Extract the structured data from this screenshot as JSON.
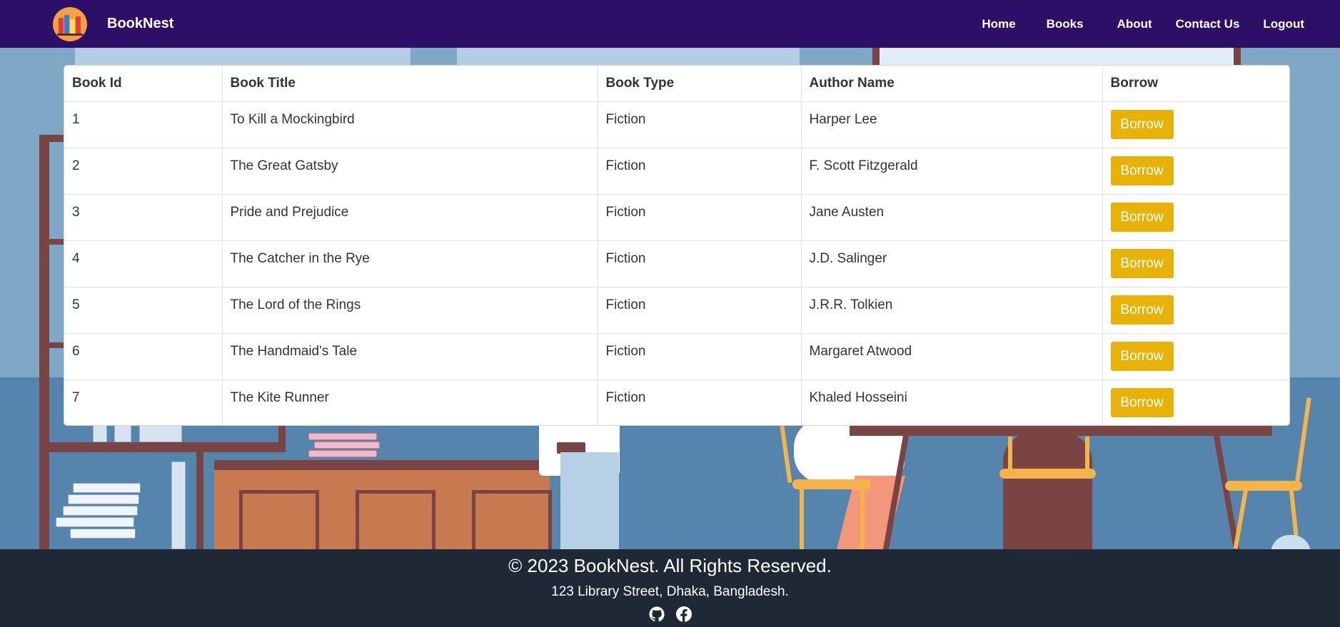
{
  "navbar": {
    "brand": "BookNest",
    "links": [
      "Home",
      "Books",
      "About",
      "Contact Us",
      "Logout"
    ],
    "logo_icon": "books-logo-icon"
  },
  "table": {
    "headers": [
      "Book Id",
      "Book Title",
      "Book Type",
      "Author Name",
      "Borrow"
    ],
    "rows": [
      {
        "id": "1",
        "title": "To Kill a Mockingbird",
        "type": "Fiction",
        "author": "Harper Lee",
        "action": "Borrow"
      },
      {
        "id": "2",
        "title": "The Great Gatsby",
        "type": "Fiction",
        "author": "F. Scott Fitzgerald",
        "action": "Borrow"
      },
      {
        "id": "3",
        "title": "Pride and Prejudice",
        "type": "Fiction",
        "author": "Jane Austen",
        "action": "Borrow"
      },
      {
        "id": "4",
        "title": "The Catcher in the Rye",
        "type": "Fiction",
        "author": "J.D. Salinger",
        "action": "Borrow"
      },
      {
        "id": "5",
        "title": "The Lord of the Rings",
        "type": "Fiction",
        "author": "J.R.R. Tolkien",
        "action": "Borrow"
      },
      {
        "id": "6",
        "title": "The Handmaid's Tale",
        "type": "Fiction",
        "author": "Margaret Atwood",
        "action": "Borrow"
      },
      {
        "id": "7",
        "title": "The Kite Runner",
        "type": "Fiction",
        "author": "Khaled Hosseini",
        "action": "Borrow"
      }
    ]
  },
  "footer": {
    "copyright": "© 2023 BookNest. All Rights Reserved.",
    "address": "123 Library Street, Dhaka, Bangladesh.",
    "socials": [
      "github-icon",
      "facebook-icon"
    ]
  },
  "colors": {
    "navbar": "#2e0f68",
    "button": "#e8b308",
    "footer": "#1f2835",
    "background": "#5a87ad"
  }
}
